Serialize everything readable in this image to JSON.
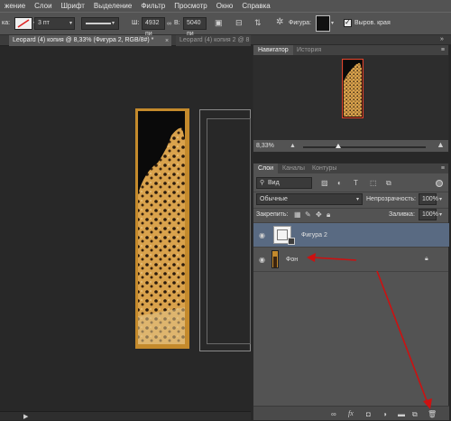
{
  "menubar": {
    "items": [
      "жение",
      "Слои",
      "Шрифт",
      "Выделение",
      "Фильтр",
      "Просмотр",
      "Окно",
      "Справка"
    ]
  },
  "options": {
    "stroke_label": "ка:",
    "stroke_size": "3 пт",
    "width_label": "Ш:",
    "width_value": "4932 пи",
    "height_label": "В:",
    "height_value": "5040 пи",
    "shape_label": "Фигура:",
    "align_edges_label": "Выров. края",
    "align_edges_checked": true
  },
  "documents": {
    "tabs": [
      {
        "label": "Leopard (4) копия @ 8,33% (Фигура 2, RGB/8#) *",
        "active": true
      },
      {
        "label": "Leopard (4) копия 2 @ 8",
        "active": false
      }
    ]
  },
  "navigator": {
    "tabs": [
      "Навигатор",
      "История"
    ],
    "zoom": "8,33%"
  },
  "layers_panel": {
    "tabs": [
      "Слои",
      "Каналы",
      "Контуры"
    ],
    "filter_kind": "Вид",
    "blend_mode": "Обычные",
    "opacity_label": "Непрозрачность:",
    "opacity_value": "100%",
    "lock_label": "Закрепить:",
    "fill_label": "Заливка:",
    "fill_value": "100%",
    "layers": [
      {
        "name": "Фигура 2",
        "selected": true,
        "locked": false
      },
      {
        "name": "Фон",
        "selected": false,
        "locked": true
      }
    ],
    "footer_icons": [
      "link-icon",
      "fx-icon",
      "mask-icon",
      "adjustment-icon",
      "folder-icon",
      "new-layer-icon",
      "trash-icon"
    ]
  },
  "colors": {
    "ui_gray": "#535353",
    "selected_layer": "#596a82",
    "accent_arrow": "#cc1111",
    "navigator_frame": "#e0442c",
    "artwork_frame": "#c48a2c"
  },
  "icons": {
    "rotate_hint": "↺"
  }
}
